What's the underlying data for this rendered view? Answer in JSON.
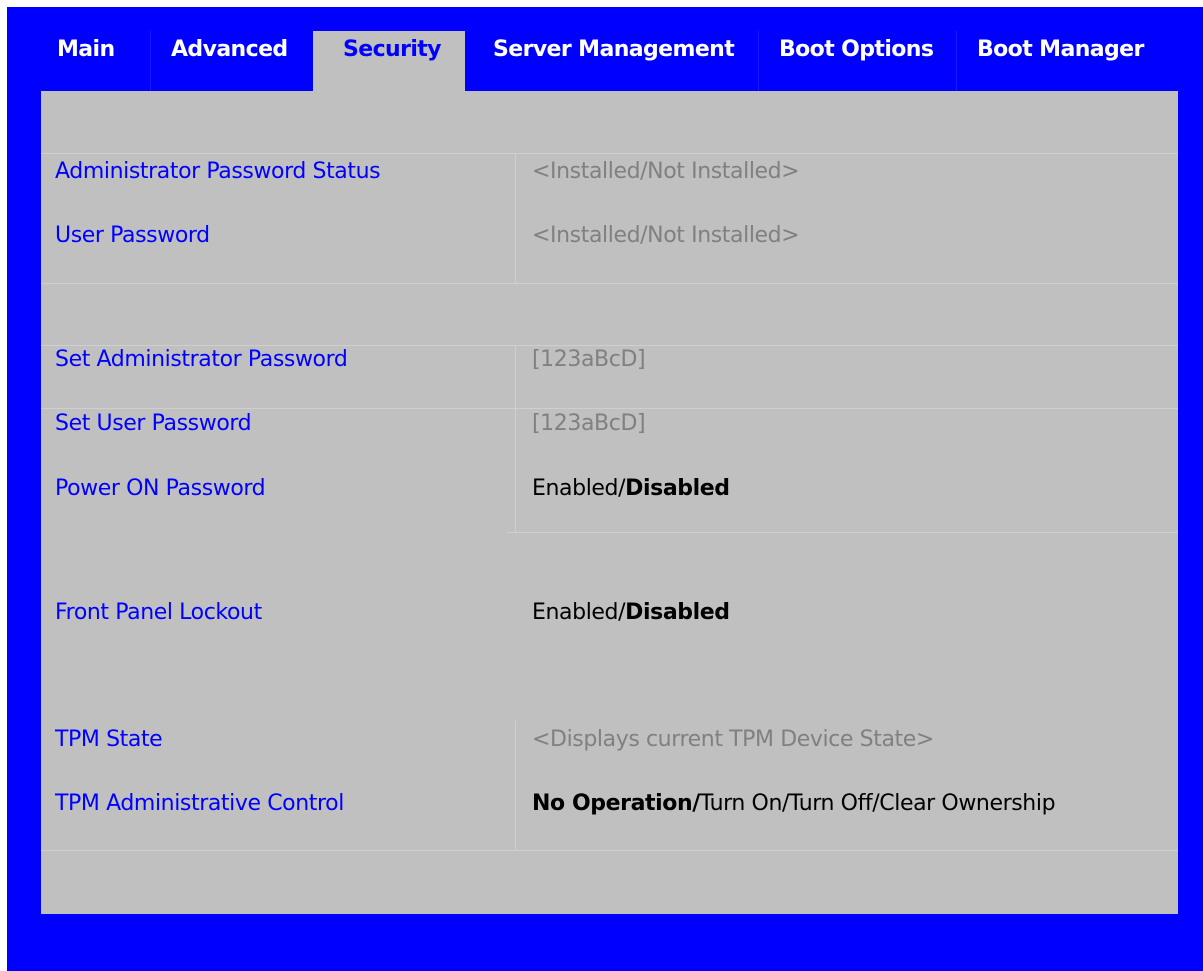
{
  "tabs": [
    {
      "label": "Main",
      "active": false
    },
    {
      "label": "Advanced",
      "active": false
    },
    {
      "label": "Security",
      "active": true
    },
    {
      "label": "Server Management",
      "active": false
    },
    {
      "label": "Boot Options",
      "active": false
    },
    {
      "label": "Boot Manager",
      "active": false
    }
  ],
  "settings": {
    "admin_password_status": {
      "label": "Administrator Password Status",
      "value": "<Installed/Not Installed>"
    },
    "user_password": {
      "label": "User Password",
      "value": "<Installed/Not Installed>"
    },
    "set_admin_password": {
      "label": "Set Administrator Password",
      "value": "[123aBcD]"
    },
    "set_user_password": {
      "label": "Set User Password",
      "value": "[123aBcD]"
    },
    "power_on_password": {
      "label": "Power ON Password",
      "option_normal": "Enabled/",
      "option_selected": "Disabled"
    },
    "front_panel_lockout": {
      "label": "Front Panel Lockout",
      "option_normal": "Enabled/",
      "option_selected": "Disabled"
    },
    "tpm_state": {
      "label": "TPM State",
      "value": "<Displays current TPM Device State>"
    },
    "tpm_admin_control": {
      "label": "TPM Administrative Control",
      "option_selected": "No Operation/",
      "option_normal": "Turn On/Turn Off/Clear Ownership"
    }
  },
  "colors": {
    "frame": "#0000ff",
    "panel": "#c0c0c0",
    "label": "#0000ff",
    "info_value": "#808080"
  }
}
